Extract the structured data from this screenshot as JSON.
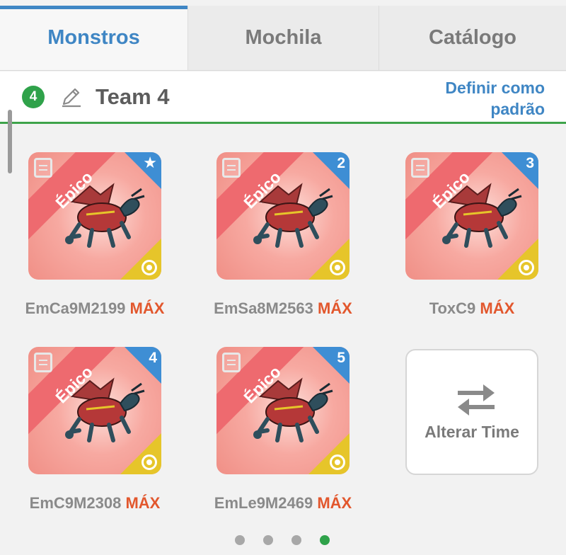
{
  "tabs": [
    {
      "label": "Monstros",
      "active": true
    },
    {
      "label": "Mochila",
      "active": false
    },
    {
      "label": "Catálogo",
      "active": false
    }
  ],
  "team": {
    "number": "4",
    "name": "Team 4",
    "set_default_label": "Definir como padrão"
  },
  "monsters": [
    {
      "rarity": "Épico",
      "slot": "star",
      "name": "EmCa9M2199",
      "level": "MÁX"
    },
    {
      "rarity": "Épico",
      "slot": "2",
      "name": "EmSa8M2563",
      "level": "MÁX"
    },
    {
      "rarity": "Épico",
      "slot": "3",
      "name": "ToxC9",
      "level": "MÁX"
    },
    {
      "rarity": "Épico",
      "slot": "4",
      "name": "EmC9M2308",
      "level": "MÁX"
    },
    {
      "rarity": "Épico",
      "slot": "5",
      "name": "EmLe9M2469",
      "level": "MÁX"
    }
  ],
  "switch_team": {
    "label": "Alterar Time",
    "icon": "swap-arrows-icon"
  },
  "pagination": {
    "pages": 4,
    "current": 4
  },
  "colors": {
    "accent_blue": "#3f86c4",
    "accent_green": "#2fa24a",
    "max_orange": "#e2572d",
    "epic_pink": "#ee6a6f",
    "zodiac_gold": "#e6c52a"
  }
}
